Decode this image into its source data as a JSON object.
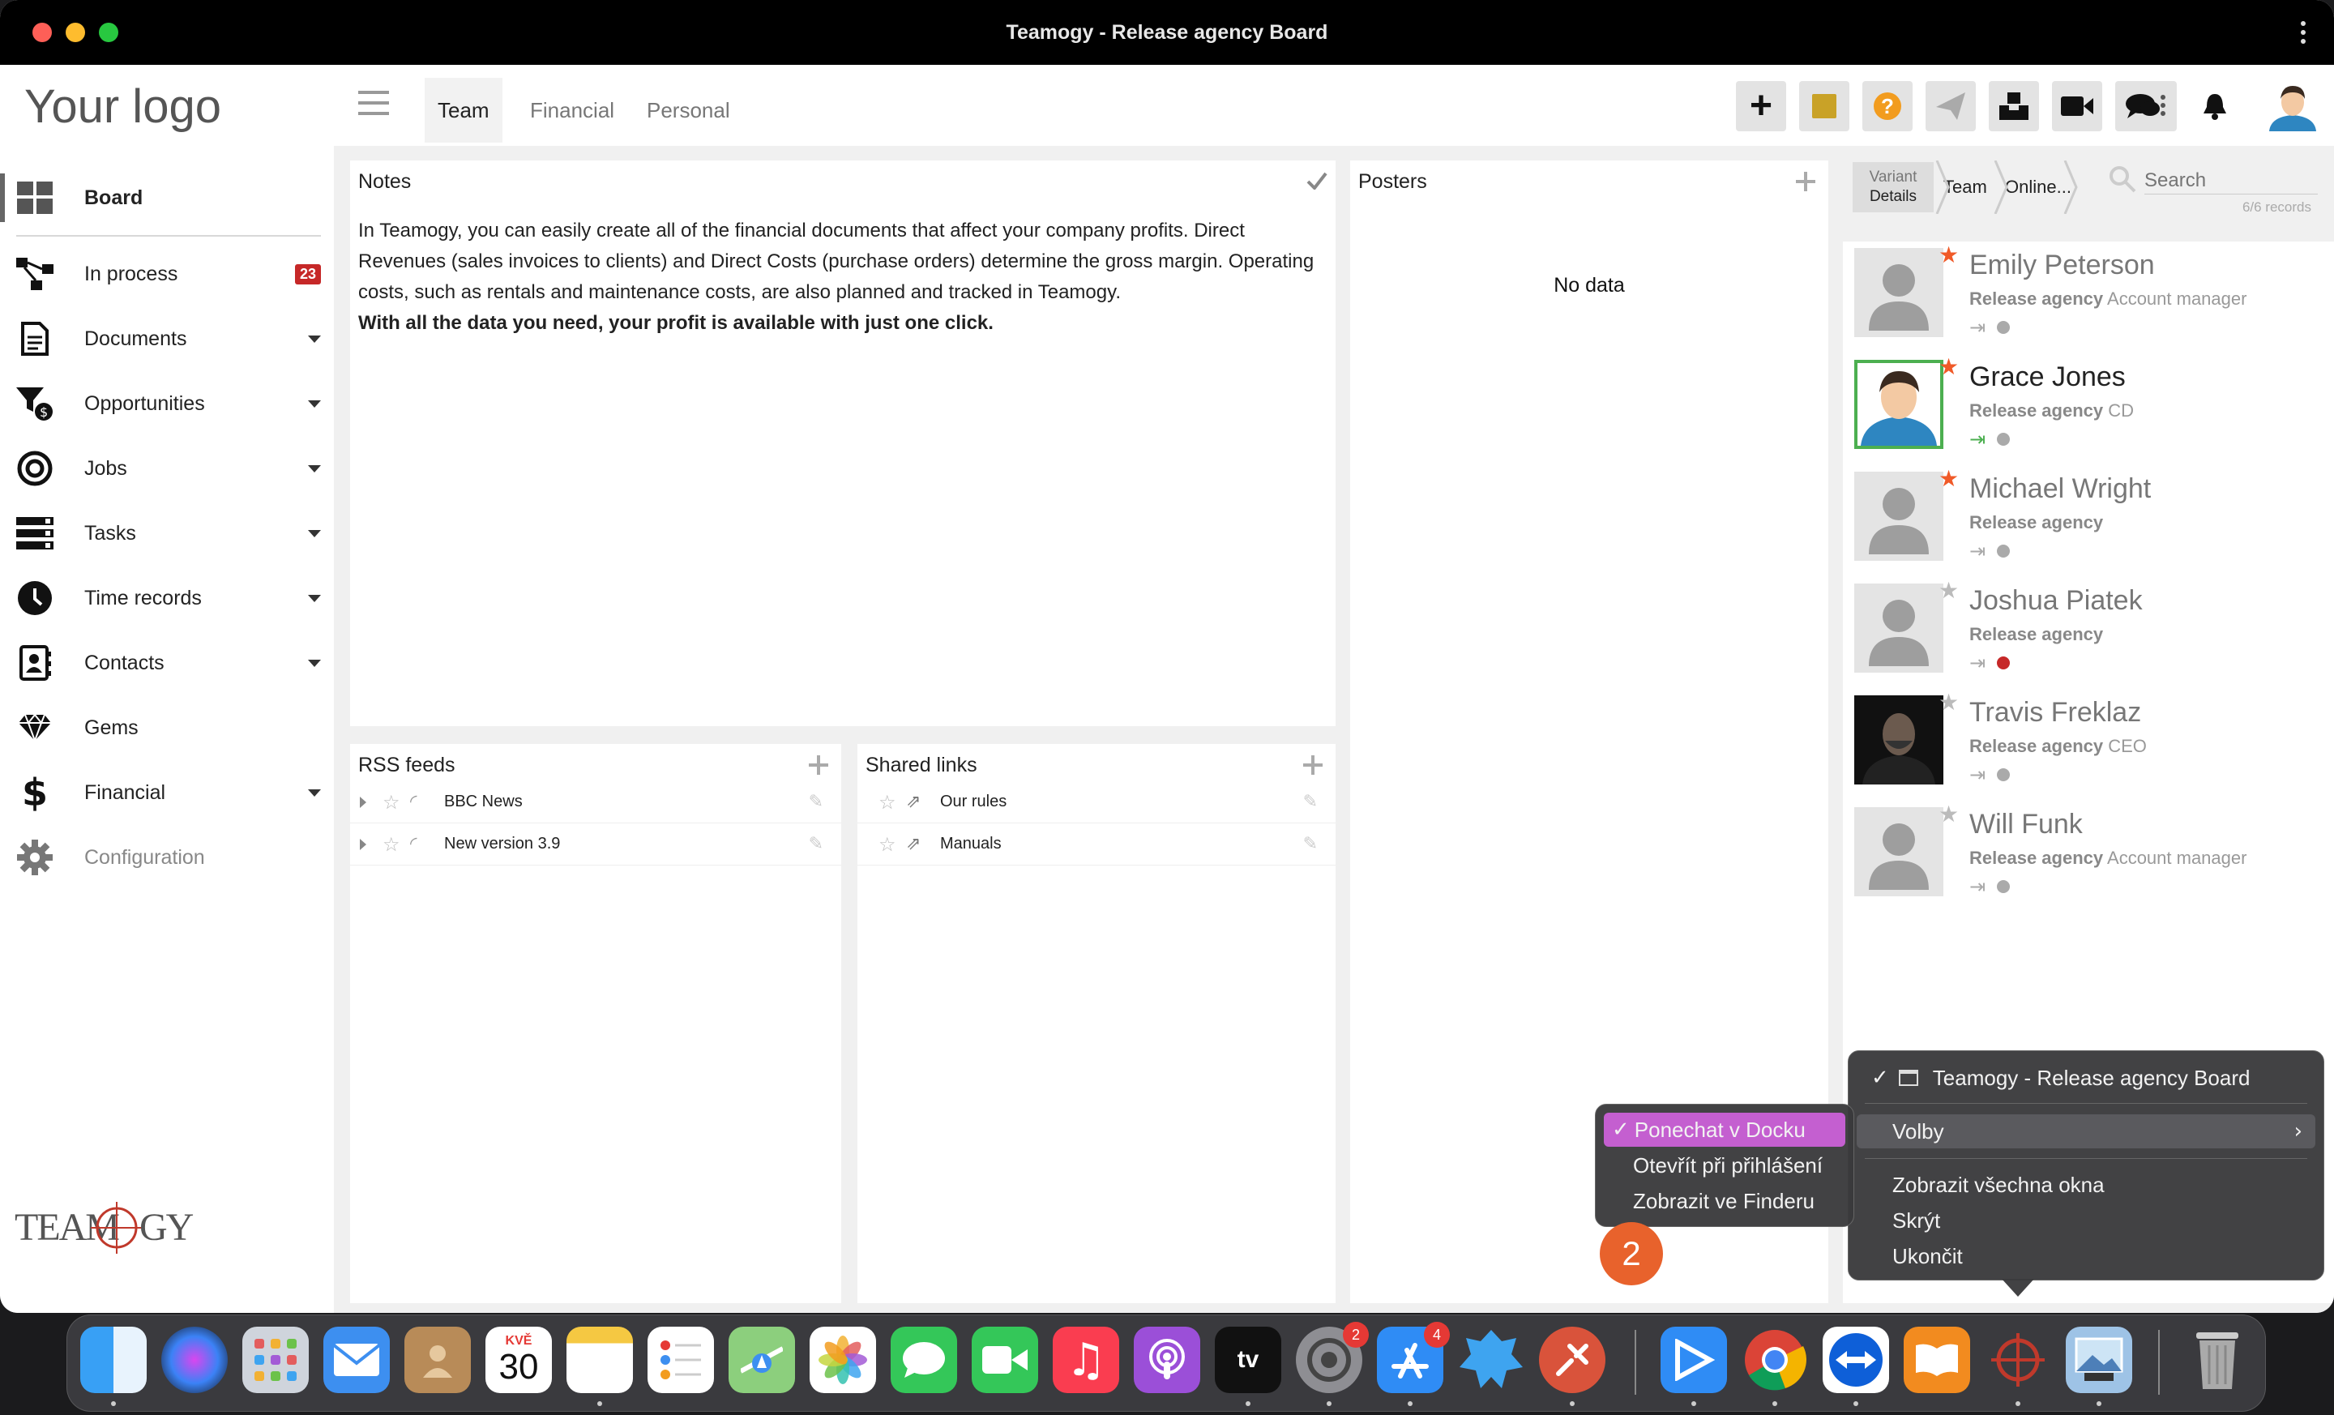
{
  "window": {
    "title": "Teamogy - Release agency Board"
  },
  "sidebar": {
    "logo": "Your logo",
    "items": [
      {
        "label": "Board",
        "icon": "board-grid-icon"
      },
      {
        "label": "In process",
        "icon": "process-flow-icon",
        "badge": "23"
      },
      {
        "label": "Documents",
        "icon": "document-icon"
      },
      {
        "label": "Opportunities",
        "icon": "funnel-dollar-icon"
      },
      {
        "label": "Jobs",
        "icon": "target-icon"
      },
      {
        "label": "Tasks",
        "icon": "tasks-stack-icon"
      },
      {
        "label": "Time records",
        "icon": "clock-icon"
      },
      {
        "label": "Contacts",
        "icon": "contact-card-icon"
      },
      {
        "label": "Gems",
        "icon": "gem-icon"
      },
      {
        "label": "Financial",
        "icon": "dollar-icon"
      },
      {
        "label": "Configuration",
        "icon": "gear-icon"
      }
    ],
    "brand": "TEAMOGY"
  },
  "header": {
    "tabs": [
      "Team",
      "Financial",
      "Personal"
    ],
    "toolbar": [
      "add-icon",
      "sticky-note-icon",
      "help-icon",
      "send-icon",
      "inbox-icon",
      "video-icon",
      "chat-icon",
      "bell-icon",
      "user-avatar-icon"
    ]
  },
  "notes": {
    "title": "Notes",
    "body": "In Teamogy, you can easily create all of the financial documents that affect your company profits. Direct Revenues (sales invoices to clients) and Direct Costs (purchase orders) determine the gross margin. Operating costs, such as rentals and maintenance costs, are also planned and tracked in Teamogy.",
    "bold": "With all the data you need, your profit is available with just one click."
  },
  "posters": {
    "title": "Posters",
    "empty": "No data"
  },
  "rss": {
    "title": "RSS feeds",
    "items": [
      "BBC News",
      "New version 3.9"
    ]
  },
  "links": {
    "title": "Shared links",
    "items": [
      "Our rules",
      "Manuals"
    ]
  },
  "people_panel": {
    "variant_line1": "Variant",
    "variant_line2": "Details",
    "crumb1": "Team",
    "crumb2": "Online...",
    "search_placeholder": "Search",
    "records": "6/6 records"
  },
  "people": [
    {
      "name": "Emily Peterson",
      "company": "Release agency",
      "role": "Account manager",
      "star": "orange"
    },
    {
      "name": "Grace Jones",
      "company": "Release agency",
      "role": "CD",
      "star": "orange",
      "online": true
    },
    {
      "name": "Michael Wright",
      "company": "Release agency",
      "role": "",
      "star": "orange"
    },
    {
      "name": "Joshua Piatek",
      "company": "Release agency",
      "role": "",
      "star": "gray",
      "timer": "red"
    },
    {
      "name": "Travis Freklaz",
      "company": "Release agency",
      "role": "CEO",
      "star": "gray"
    },
    {
      "name": "Will Funk",
      "company": "Release agency",
      "role": "Account manager",
      "star": "gray"
    }
  ],
  "context_menu": {
    "window_item": "Teamogy - Release agency Board",
    "options": "Volby",
    "show_all": "Zobrazit všechna okna",
    "hide": "Skrýt",
    "quit": "Ukončit"
  },
  "submenu": {
    "keep": "Ponechat v Docku",
    "open_login": "Otevřít při přihlášení",
    "show_finder": "Zobrazit ve Finderu"
  },
  "step_marker": "2",
  "dock": {
    "calendar_month": "KVĚ",
    "calendar_day": "30",
    "badges": {
      "settings": "2",
      "appstore": "4"
    },
    "tv_label": "tv"
  }
}
